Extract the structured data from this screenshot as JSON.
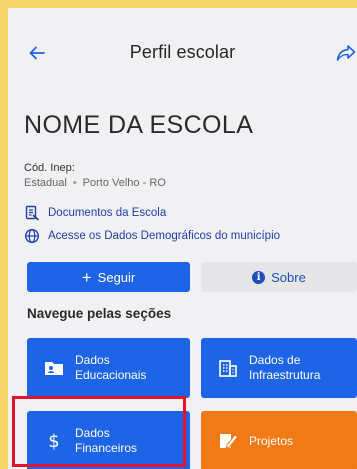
{
  "header": {
    "title": "Perfil escolar",
    "back_icon": "arrow-left-icon",
    "share_icon": "share-icon"
  },
  "school": {
    "name": "NOME DA ESCOLA",
    "inep_label": "Cód. Inep:",
    "network": "Estadual",
    "separator": "•",
    "location": "Porto Velho - RO"
  },
  "links": {
    "documents": "Documentos da Escola",
    "demographics": "Acesse os Dados Demográficos do município"
  },
  "actions": {
    "follow_label": "Seguir",
    "follow_prefix": "+",
    "about_label": "Sobre",
    "about_icon_glyph": "i"
  },
  "sections": {
    "heading": "Navegue pelas seções",
    "tiles": [
      {
        "line1": "Dados",
        "line2": "Educacionais",
        "icon": "student-card-icon",
        "color": "#1e64e6"
      },
      {
        "line1": "Dados de",
        "line2": "Infraestrutura",
        "icon": "building-icon",
        "color": "#1e64e6"
      },
      {
        "line1": "Dados",
        "line2": "Financeiros",
        "icon": "dollar-icon",
        "color": "#1e64e6"
      },
      {
        "line1": "Projetos",
        "line2": "",
        "icon": "pencil-icon",
        "color": "#f07a16"
      }
    ]
  },
  "colors": {
    "primary": "#1e64e6",
    "link": "#1f3fa8",
    "orange": "#f07a16",
    "highlight": "#e0142a",
    "outer_frame": "#f6d66a"
  }
}
